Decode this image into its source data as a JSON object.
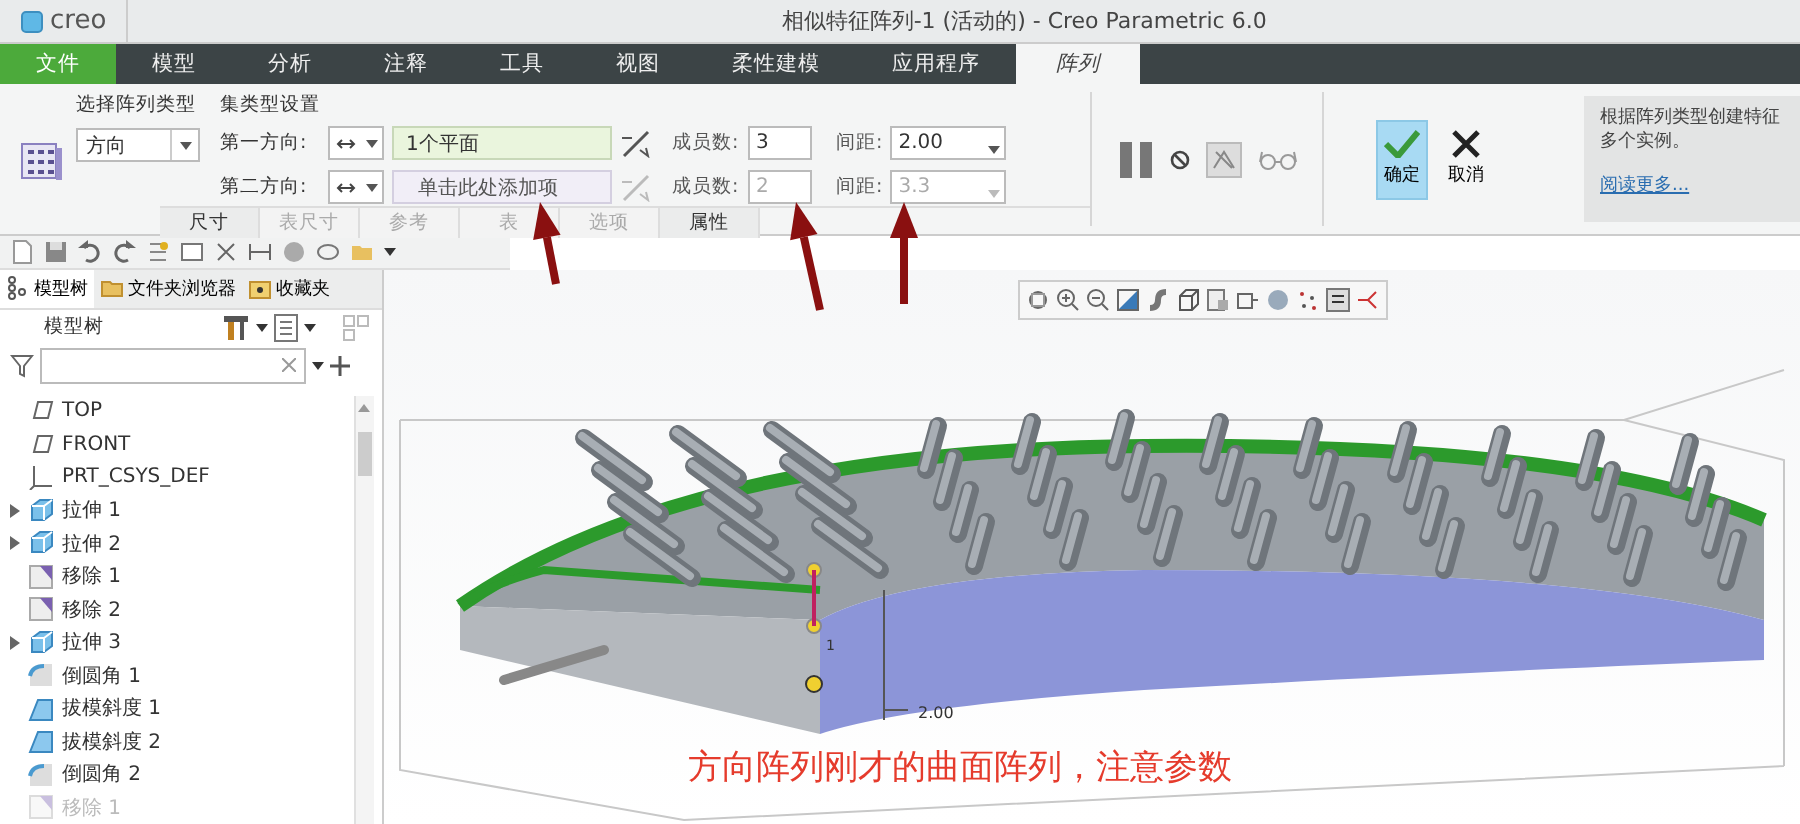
{
  "title_bar": {
    "logo": "creo",
    "title": "相似特征阵列-1 (活动的) - Creo Parametric 6.0"
  },
  "menu_tabs": [
    {
      "label": "文件",
      "kind": "file",
      "selected": false
    },
    {
      "label": "模型",
      "kind": "tab",
      "selected": false
    },
    {
      "label": "分析",
      "kind": "tab",
      "selected": false
    },
    {
      "label": "注释",
      "kind": "tab",
      "selected": false
    },
    {
      "label": "工具",
      "kind": "tab",
      "selected": false
    },
    {
      "label": "视图",
      "kind": "tab",
      "selected": false
    },
    {
      "label": "柔性建模",
      "kind": "tab",
      "selected": false
    },
    {
      "label": "应用程序",
      "kind": "tab",
      "selected": false
    },
    {
      "label": "阵列",
      "kind": "tab",
      "selected": true
    }
  ],
  "ribbon": {
    "type_label": "选择阵列类型",
    "type_value": "方向",
    "set_label": "集类型设置",
    "rows": [
      {
        "label": "第一方向:",
        "value": "1个平面",
        "count_label": "成员数:",
        "count": "3",
        "spacing_label": "间距:",
        "spacing": "2.00",
        "disabled": false
      },
      {
        "label": "第二方向:",
        "placeholder": "单击此处添加项",
        "count_label": "成员数:",
        "count": "2",
        "spacing_label": "间距:",
        "spacing": "3.3",
        "disabled": true
      }
    ],
    "sub_tabs": [
      {
        "label": "尺寸",
        "disabled": false
      },
      {
        "label": "表尺寸",
        "disabled": true
      },
      {
        "label": "参考",
        "disabled": true
      },
      {
        "label": "表",
        "disabled": true
      },
      {
        "label": "选项",
        "disabled": true
      },
      {
        "label": "属性",
        "disabled": false
      }
    ],
    "ok": "确定",
    "cancel": "取消",
    "help_lines": [
      "根据阵列类型创建特征",
      "多个实例。"
    ],
    "help_link": "阅读更多..."
  },
  "panel_tabs": [
    {
      "label": "模型树",
      "kind": "tree",
      "selected": true
    },
    {
      "label": "文件夹浏览器",
      "kind": "folder",
      "selected": false
    },
    {
      "label": "收藏夹",
      "kind": "favorites",
      "selected": false
    }
  ],
  "tree_title": "模型树",
  "tree": [
    {
      "label": "TOP",
      "kind": "plane",
      "expandable": false,
      "disabled": false
    },
    {
      "label": "FRONT",
      "kind": "plane",
      "expandable": false,
      "disabled": false
    },
    {
      "label": "PRT_CSYS_DEF",
      "kind": "csys",
      "expandable": false,
      "disabled": false
    },
    {
      "label": "拉伸 1",
      "kind": "extrude",
      "expandable": true,
      "disabled": false
    },
    {
      "label": "拉伸 2",
      "kind": "extrude",
      "expandable": true,
      "disabled": false
    },
    {
      "label": "移除 1",
      "kind": "remove",
      "expandable": false,
      "disabled": false
    },
    {
      "label": "移除 2",
      "kind": "remove",
      "expandable": false,
      "disabled": false
    },
    {
      "label": "拉伸 3",
      "kind": "extrude",
      "expandable": true,
      "disabled": false
    },
    {
      "label": "倒圆角 1",
      "kind": "round",
      "expandable": false,
      "disabled": false
    },
    {
      "label": "拔模斜度 1",
      "kind": "draft",
      "expandable": false,
      "disabled": false
    },
    {
      "label": "拔模斜度 2",
      "kind": "draft",
      "expandable": false,
      "disabled": false
    },
    {
      "label": "倒圆角 2",
      "kind": "round",
      "expandable": false,
      "disabled": false
    },
    {
      "label": "移除 1",
      "kind": "remove",
      "expandable": false,
      "disabled": true
    }
  ],
  "viewport": {
    "dimension": "2.00",
    "handle_label": "1",
    "caption": "方向阵列刚才的曲面阵列，注意参数"
  }
}
